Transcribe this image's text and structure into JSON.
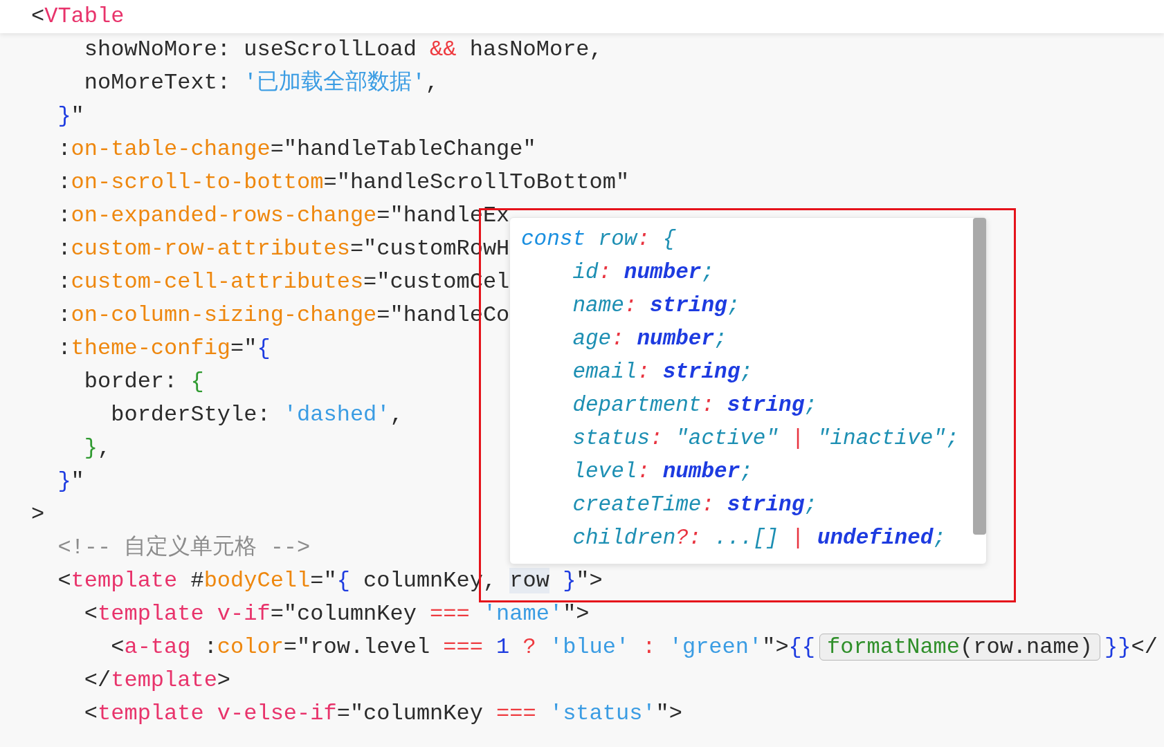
{
  "header": {
    "tokens": [
      {
        "text": "<",
        "kind": "plain"
      },
      {
        "text": "VTable",
        "kind": "tag"
      }
    ]
  },
  "lines": [
    {
      "tokens": [
        {
          "text": "    showNoMore: useScrollLoad ",
          "kind": "plain"
        },
        {
          "text": "&&",
          "kind": "op"
        },
        {
          "text": " hasNoMore,",
          "kind": "plain"
        }
      ]
    },
    {
      "tokens": [
        {
          "text": "    noMoreText: ",
          "kind": "plain"
        },
        {
          "text": "'已加载全部数据'",
          "kind": "string"
        },
        {
          "text": ",",
          "kind": "plain"
        }
      ]
    },
    {
      "tokens": [
        {
          "text": "  }",
          "kind": "brace1"
        },
        {
          "text": "\"",
          "kind": "plain"
        }
      ]
    },
    {
      "tokens": [
        {
          "text": "  :",
          "kind": "plain"
        },
        {
          "text": "on-table-change",
          "kind": "attr"
        },
        {
          "text": "=\"handleTableChange\"",
          "kind": "plain"
        }
      ]
    },
    {
      "tokens": [
        {
          "text": "  :",
          "kind": "plain"
        },
        {
          "text": "on-scroll-to-bottom",
          "kind": "attr"
        },
        {
          "text": "=\"handleScrollToBottom\"",
          "kind": "plain"
        }
      ]
    },
    {
      "tokens": [
        {
          "text": "  :",
          "kind": "plain"
        },
        {
          "text": "on-expanded-rows-change",
          "kind": "attr"
        },
        {
          "text": "=\"handleEx",
          "kind": "plain"
        }
      ]
    },
    {
      "tokens": [
        {
          "text": "  :",
          "kind": "plain"
        },
        {
          "text": "custom-row-attributes",
          "kind": "attr"
        },
        {
          "text": "=\"customRowH",
          "kind": "plain"
        }
      ]
    },
    {
      "tokens": [
        {
          "text": "  :",
          "kind": "plain"
        },
        {
          "text": "custom-cell-attributes",
          "kind": "attr"
        },
        {
          "text": "=\"customCel",
          "kind": "plain"
        }
      ]
    },
    {
      "tokens": [
        {
          "text": "  :",
          "kind": "plain"
        },
        {
          "text": "on-column-sizing-change",
          "kind": "attr"
        },
        {
          "text": "=\"handleCo",
          "kind": "plain"
        }
      ]
    },
    {
      "tokens": [
        {
          "text": "  :",
          "kind": "plain"
        },
        {
          "text": "theme-config",
          "kind": "attr"
        },
        {
          "text": "=\"",
          "kind": "plain"
        },
        {
          "text": "{",
          "kind": "brace1"
        }
      ]
    },
    {
      "tokens": [
        {
          "text": "    border: ",
          "kind": "plain"
        },
        {
          "text": "{",
          "kind": "brace2"
        }
      ]
    },
    {
      "tokens": [
        {
          "text": "      borderStyle: ",
          "kind": "plain"
        },
        {
          "text": "'dashed'",
          "kind": "string"
        },
        {
          "text": ",",
          "kind": "plain"
        }
      ]
    },
    {
      "tokens": [
        {
          "text": "    }",
          "kind": "brace2"
        },
        {
          "text": ",",
          "kind": "plain"
        }
      ]
    },
    {
      "tokens": [
        {
          "text": "  }",
          "kind": "brace1"
        },
        {
          "text": "\"",
          "kind": "plain"
        }
      ]
    },
    {
      "tokens": [
        {
          "text": ">",
          "kind": "plain"
        }
      ]
    },
    {
      "tokens": [
        {
          "text": "  <!-- 自定义单元格 -->",
          "kind": "comment"
        }
      ]
    },
    {
      "tokens": [
        {
          "text": "  <",
          "kind": "plain"
        },
        {
          "text": "template",
          "kind": "tag"
        },
        {
          "text": " #",
          "kind": "plain"
        },
        {
          "text": "bodyCell",
          "kind": "attr"
        },
        {
          "text": "=\"",
          "kind": "plain"
        },
        {
          "text": "{",
          "kind": "brace1"
        },
        {
          "text": " columnKey, ",
          "kind": "plain"
        },
        {
          "text": "row",
          "kind": "highlight"
        },
        {
          "text": " }",
          "kind": "brace1"
        },
        {
          "text": "\">",
          "kind": "plain"
        }
      ]
    },
    {
      "tokens": [
        {
          "text": "    <",
          "kind": "plain"
        },
        {
          "text": "template",
          "kind": "tag"
        },
        {
          "text": " v-if",
          "kind": "tag"
        },
        {
          "text": "=\"columnKey ",
          "kind": "plain"
        },
        {
          "text": "===",
          "kind": "op"
        },
        {
          "text": " 'name'",
          "kind": "string"
        },
        {
          "text": "\">",
          "kind": "plain"
        }
      ]
    },
    {
      "tokens": [
        {
          "text": "      <",
          "kind": "plain"
        },
        {
          "text": "a-tag",
          "kind": "tag"
        },
        {
          "text": " :",
          "kind": "plain"
        },
        {
          "text": "color",
          "kind": "attr"
        },
        {
          "text": "=\"row.level ",
          "kind": "plain"
        },
        {
          "text": "===",
          "kind": "op"
        },
        {
          "text": " 1",
          "kind": "number"
        },
        {
          "text": " ?",
          "kind": "op"
        },
        {
          "text": " 'blue'",
          "kind": "string"
        },
        {
          "text": " :",
          "kind": "op"
        },
        {
          "text": " 'green'",
          "kind": "string"
        },
        {
          "text": "\">",
          "kind": "plain"
        },
        {
          "text": "{{",
          "kind": "brace1"
        },
        {
          "kind": "inlay",
          "tokens": [
            {
              "text": "formatName",
              "kind": "fn"
            },
            {
              "text": "(row.name)",
              "kind": "plain"
            }
          ]
        },
        {
          "text": "}}",
          "kind": "brace1"
        },
        {
          "text": "</",
          "kind": "plain"
        }
      ]
    },
    {
      "tokens": [
        {
          "text": "    </",
          "kind": "plain"
        },
        {
          "text": "template",
          "kind": "tag"
        },
        {
          "text": ">",
          "kind": "plain"
        }
      ]
    },
    {
      "tokens": [
        {
          "text": "    <",
          "kind": "plain"
        },
        {
          "text": "template",
          "kind": "tag"
        },
        {
          "text": " v-else-if",
          "kind": "tag"
        },
        {
          "text": "=\"columnKey ",
          "kind": "plain"
        },
        {
          "text": "===",
          "kind": "op"
        },
        {
          "text": " 'status'",
          "kind": "string"
        },
        {
          "text": "\">",
          "kind": "plain"
        }
      ]
    }
  ],
  "tooltip": {
    "lines": [
      {
        "tokens": [
          {
            "text": "const",
            "kind": "keyword"
          },
          {
            "text": " row",
            "kind": "prop"
          },
          {
            "text": ":",
            "kind": "colon"
          },
          {
            "text": " {",
            "kind": "prop"
          }
        ]
      },
      {
        "tokens": [
          {
            "text": "    id",
            "kind": "prop"
          },
          {
            "text": ":",
            "kind": "colon"
          },
          {
            "text": " number",
            "kind": "type"
          },
          {
            "text": ";",
            "kind": "prop"
          }
        ]
      },
      {
        "tokens": [
          {
            "text": "    name",
            "kind": "prop"
          },
          {
            "text": ":",
            "kind": "colon"
          },
          {
            "text": " string",
            "kind": "type"
          },
          {
            "text": ";",
            "kind": "prop"
          }
        ]
      },
      {
        "tokens": [
          {
            "text": "    age",
            "kind": "prop"
          },
          {
            "text": ":",
            "kind": "colon"
          },
          {
            "text": " number",
            "kind": "type"
          },
          {
            "text": ";",
            "kind": "prop"
          }
        ]
      },
      {
        "tokens": [
          {
            "text": "    email",
            "kind": "prop"
          },
          {
            "text": ":",
            "kind": "colon"
          },
          {
            "text": " string",
            "kind": "type"
          },
          {
            "text": ";",
            "kind": "prop"
          }
        ]
      },
      {
        "tokens": [
          {
            "text": "    department",
            "kind": "prop"
          },
          {
            "text": ":",
            "kind": "colon"
          },
          {
            "text": " string",
            "kind": "type"
          },
          {
            "text": ";",
            "kind": "prop"
          }
        ]
      },
      {
        "tokens": [
          {
            "text": "    status",
            "kind": "prop"
          },
          {
            "text": ":",
            "kind": "colon"
          },
          {
            "text": " \"active\"",
            "kind": "prop"
          },
          {
            "text": " |",
            "kind": "colon"
          },
          {
            "text": " \"inactive\";",
            "kind": "prop"
          }
        ]
      },
      {
        "tokens": [
          {
            "text": "    level",
            "kind": "prop"
          },
          {
            "text": ":",
            "kind": "colon"
          },
          {
            "text": " number",
            "kind": "type"
          },
          {
            "text": ";",
            "kind": "prop"
          }
        ]
      },
      {
        "tokens": [
          {
            "text": "    createTime",
            "kind": "prop"
          },
          {
            "text": ":",
            "kind": "colon"
          },
          {
            "text": " string",
            "kind": "type"
          },
          {
            "text": ";",
            "kind": "prop"
          }
        ]
      },
      {
        "tokens": [
          {
            "text": "    children",
            "kind": "prop"
          },
          {
            "text": "?:",
            "kind": "colon"
          },
          {
            "text": " ...[]",
            "kind": "prop"
          },
          {
            "text": " |",
            "kind": "colon"
          },
          {
            "text": " undefined",
            "kind": "type"
          },
          {
            "text": ";",
            "kind": "prop"
          }
        ]
      }
    ]
  }
}
